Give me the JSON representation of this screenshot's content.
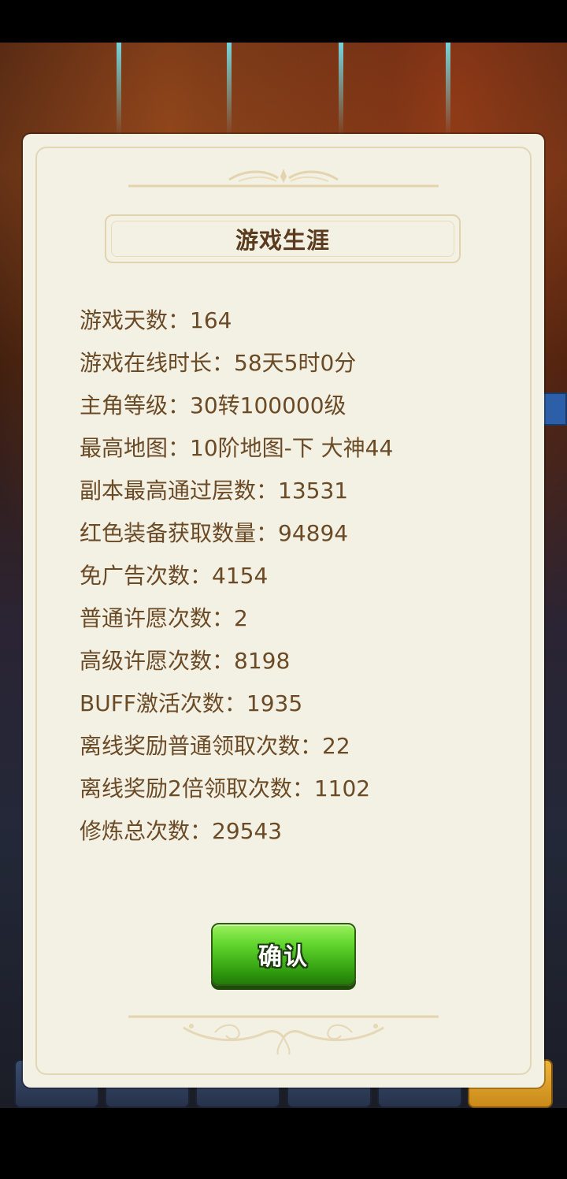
{
  "dialog": {
    "title": "游戏生涯",
    "stats": [
      "游戏天数：164",
      "游戏在线时长：58天5时0分",
      "主角等级：30转100000级",
      "最高地图：10阶地图-下 大神44",
      "副本最高通过层数：13531",
      "红色装备获取数量：94894",
      "免广告次数：4154",
      "普通许愿次数：2",
      "高级许愿次数：8198",
      "BUFF激活次数：1935",
      "离线奖励普通领取次数：22",
      "离线奖励2倍领取次数：1102",
      "修炼总次数：29543"
    ],
    "confirm_label": "确认"
  },
  "colors": {
    "panel_bg": "#f3f0e4",
    "text": "#6b4a26",
    "title_text": "#5a3b1d",
    "confirm_green": "#4fc21f"
  }
}
